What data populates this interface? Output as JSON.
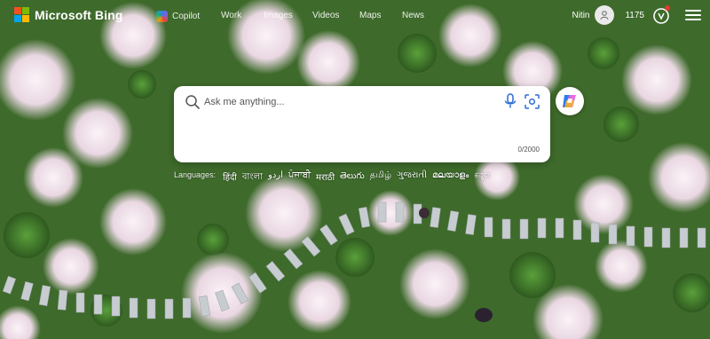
{
  "header": {
    "logo_text": "Microsoft Bing",
    "nav": [
      {
        "label": "Copilot"
      },
      {
        "label": "Work"
      },
      {
        "label": "Images"
      },
      {
        "label": "Videos"
      },
      {
        "label": "Maps"
      },
      {
        "label": "News"
      }
    ],
    "user_name": "Nitin",
    "reward_points": "1175",
    "icons": {
      "search": "search-icon",
      "mic": "microphone-icon",
      "visual_search": "visual-search-icon",
      "copilot": "copilot-icon",
      "menu": "hamburger-menu-icon",
      "rewards": "rewards-medal-icon",
      "avatar": "user-avatar-icon"
    }
  },
  "search": {
    "placeholder": "Ask me anything...",
    "char_count": "0/2000"
  },
  "languages": {
    "lead": "Languages:",
    "items": [
      "हिंदी",
      "বাংলা",
      "اردو",
      "ਪੰਜਾਬੀ",
      "मराठी",
      "తెలుగు",
      "தமிழ்",
      "ગુજરાતી",
      "മലയാളം",
      "ಕನ್ನಡ"
    ]
  },
  "colors": {
    "ms_red": "#f25022",
    "ms_green": "#7fba00",
    "ms_blue": "#00a4ef",
    "ms_yellow": "#ffb900",
    "grass": "#3f6b2c",
    "blossom": "#f3e6ee"
  }
}
